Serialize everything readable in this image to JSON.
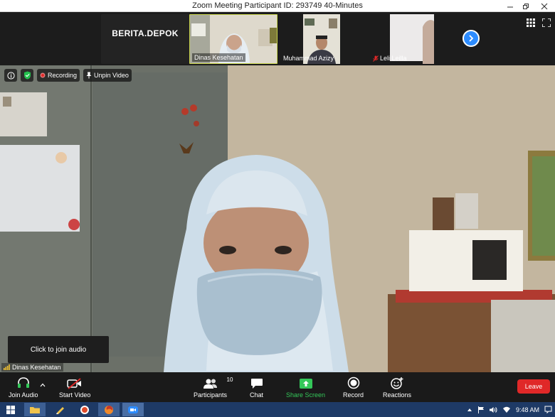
{
  "window": {
    "title": "Zoom Meeting Participant ID: 293749   40-Minutes"
  },
  "strip": {
    "tiles": [
      {
        "kind": "name",
        "label": "BERITA.DEPOK"
      },
      {
        "kind": "video",
        "label": "Dinas Kesehatan"
      },
      {
        "kind": "video",
        "label": "Muhammad Azizy"
      },
      {
        "kind": "video",
        "label": "Leli Leilla"
      }
    ]
  },
  "status": {
    "recording_label": "Recording",
    "unpin_label": "Unpin Video"
  },
  "tooltip": {
    "text": "Click to join audio"
  },
  "active_speaker": {
    "label": "Dinas Kesehatan"
  },
  "toolbar": {
    "join_audio": "Join Audio",
    "start_video": "Start Video",
    "participants": "Participants",
    "participants_count": "10",
    "chat": "Chat",
    "share_screen": "Share Screen",
    "record": "Record",
    "reactions": "Reactions",
    "leave": "Leave"
  },
  "taskbar": {
    "time": "9:48 AM"
  },
  "colors": {
    "accent": "#2d8cff",
    "share_green": "#34c759",
    "leave_red": "#e02828",
    "security_green": "#23c04d",
    "taskbar": "#1e3a66"
  },
  "icons": [
    "info-icon",
    "shield-icon",
    "record-dot-icon",
    "pin-icon",
    "gallery-view-icon",
    "fullscreen-icon",
    "chevron-right-icon",
    "headphones-icon",
    "caret-up-icon",
    "video-off-icon",
    "participants-icon",
    "chat-icon",
    "share-screen-icon",
    "record-icon",
    "reactions-icon",
    "windows-icon",
    "folder-icon",
    "zoom-icon",
    "browser-icon",
    "wifi-icon",
    "volume-icon",
    "flag-icon",
    "notification-icon",
    "mic-muted-icon",
    "signal-bars-icon"
  ]
}
